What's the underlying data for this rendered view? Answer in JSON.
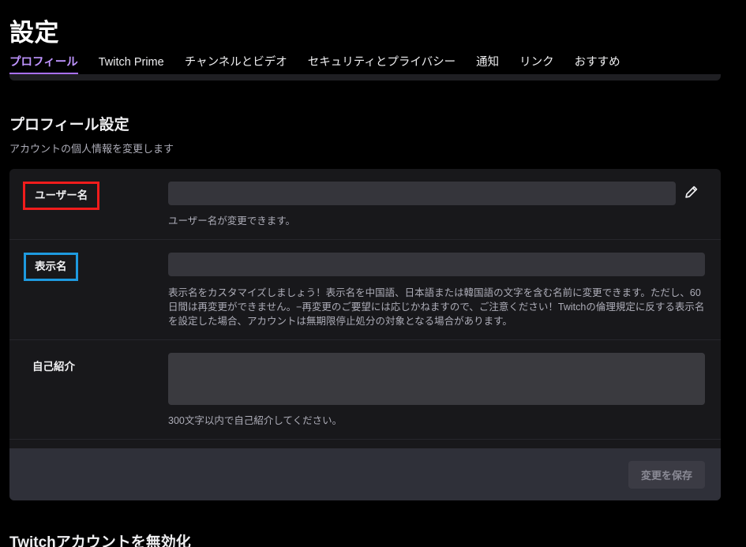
{
  "header": {
    "title": "設定",
    "tabs": [
      {
        "label": "プロフィール",
        "active": true
      },
      {
        "label": "Twitch Prime",
        "active": false
      },
      {
        "label": "チャンネルとビデオ",
        "active": false
      },
      {
        "label": "セキュリティとプライバシー",
        "active": false
      },
      {
        "label": "通知",
        "active": false
      },
      {
        "label": "リンク",
        "active": false
      },
      {
        "label": "おすすめ",
        "active": false
      }
    ],
    "active_tab_color": "#bf94ff",
    "active_tab_underline_color": "#a970ff"
  },
  "section": {
    "title": "プロフィール設定",
    "subtitle": "アカウントの個人情報を変更します"
  },
  "fields": {
    "username": {
      "label": "ユーザー名",
      "value": "",
      "placeholder": "",
      "helper": "ユーザー名が変更できます。",
      "highlight_color": "#f01c1c",
      "edit_icon": "pencil-icon"
    },
    "display_name": {
      "label": "表示名",
      "value": "",
      "placeholder": "",
      "helper": "表示名をカスタマイズしましょう！表示名を中国語、日本語または韓国語の文字を含む名前に変更できます。ただし、60日間は再変更ができません。−再変更のご要望には応じかねますので、ご注意ください！Twitchの倫理規定に反する表示名を設定した場合、アカウントは無期限停止処分の対象となる場合があります。",
      "highlight_color": "#1e9ae0"
    },
    "bio": {
      "label": "自己紹介",
      "value": "",
      "placeholder": "",
      "helper": "300文字以内で自己紹介してください。"
    }
  },
  "footer": {
    "save_label": "変更を保存",
    "save_disabled": true
  },
  "bottom_section": {
    "title": "Twitchアカウントを無効化"
  }
}
